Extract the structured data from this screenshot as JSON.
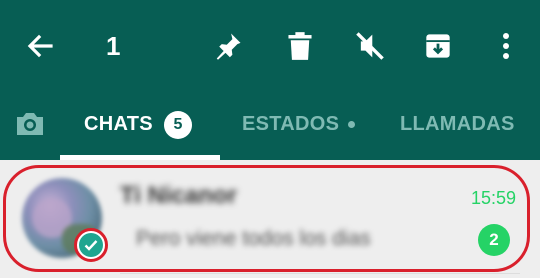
{
  "appbar": {
    "selected_count": "1",
    "actions": [
      "back-icon",
      "pin-icon",
      "delete-icon",
      "mute-icon",
      "archive-icon",
      "more-options-icon"
    ]
  },
  "tabs": {
    "camera_icon": "camera-icon",
    "items": [
      {
        "label": "CHATS",
        "badge": "5",
        "active": true
      },
      {
        "label": "ESTADOS",
        "has_dot": true,
        "active": false
      },
      {
        "label": "LLAMADAS",
        "active": false
      }
    ]
  },
  "chat": {
    "name": "Ti Nicanor",
    "preview": "Pero viene todos los dias",
    "time": "15:59",
    "unread_count": "2",
    "selected": true
  },
  "colors": {
    "appbar": "#075e54",
    "accent": "#25d366",
    "selected_check": "#1fa590",
    "highlight_outline": "#d9202c",
    "inactive_tab": "#7fbab3",
    "row_background": "#eeeeee"
  }
}
